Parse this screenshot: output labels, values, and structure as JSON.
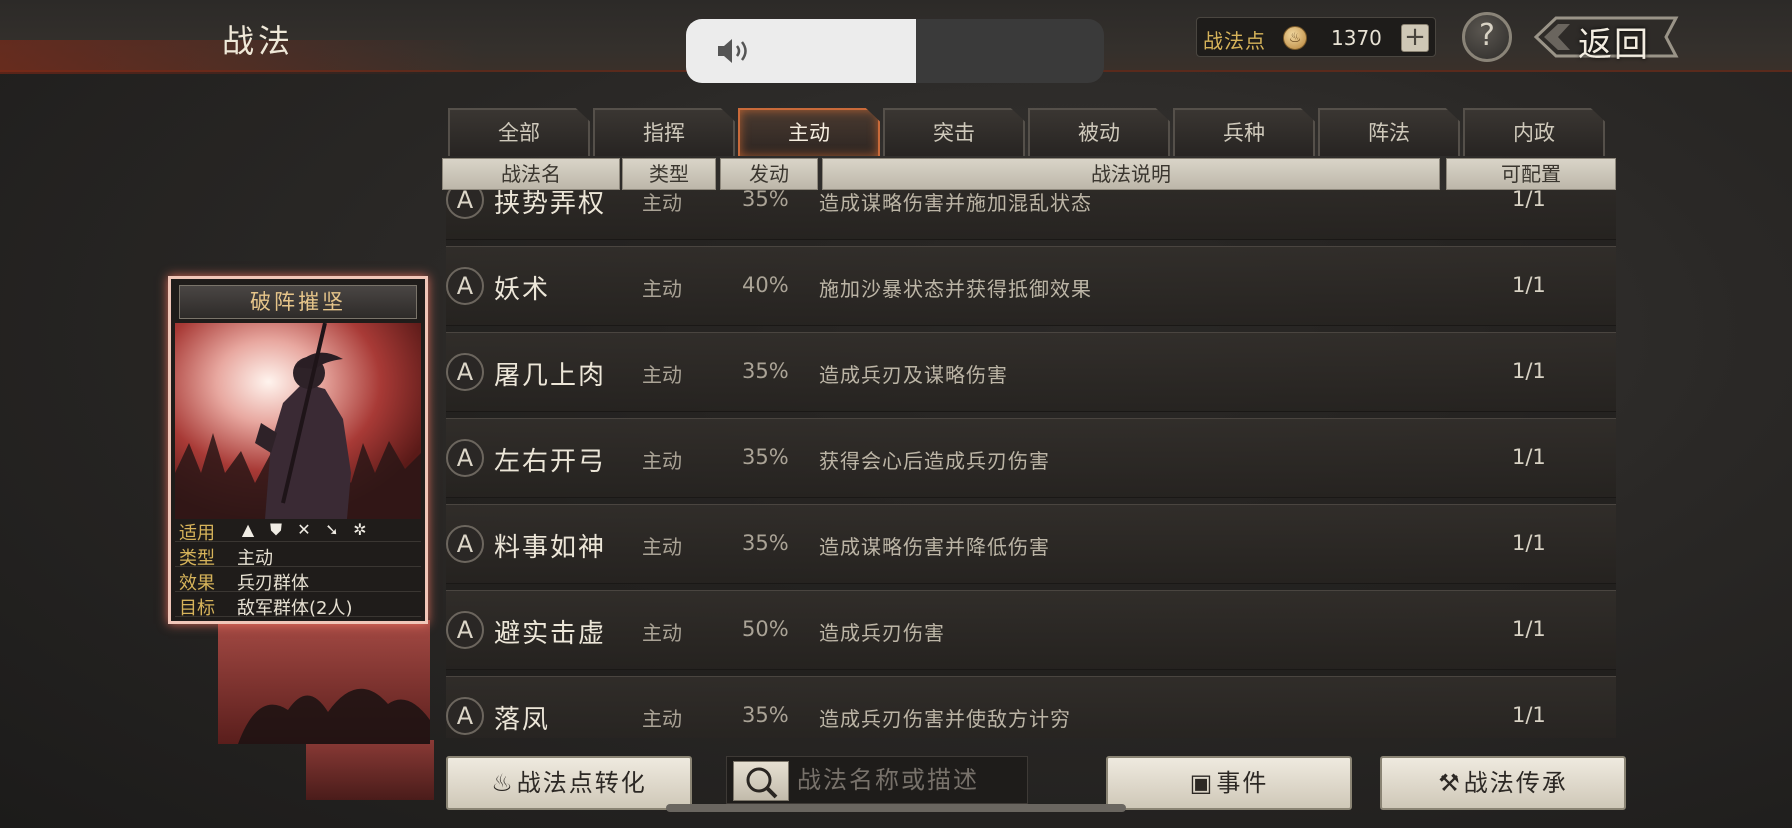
{
  "header": {
    "title": "战法",
    "points_label": "战法点",
    "points_value": "1370",
    "plus_label": "+",
    "help_label": "?",
    "back_label": "返回"
  },
  "volume": {
    "level": 0.55
  },
  "tabs": [
    {
      "label": "全部",
      "active": false
    },
    {
      "label": "指挥",
      "active": false
    },
    {
      "label": "主动",
      "active": true
    },
    {
      "label": "突击",
      "active": false
    },
    {
      "label": "被动",
      "active": false
    },
    {
      "label": "兵种",
      "active": false
    },
    {
      "label": "阵法",
      "active": false
    },
    {
      "label": "内政",
      "active": false
    }
  ],
  "columns": [
    "战法名",
    "类型",
    "发动",
    "战法说明",
    "可配置"
  ],
  "rows": [
    {
      "grade": "A",
      "name": "挟势弄权",
      "type": "主动",
      "rate": "35%",
      "desc": "造成谋略伤害并施加混乱状态",
      "slots": "1/1"
    },
    {
      "grade": "A",
      "name": "妖术",
      "type": "主动",
      "rate": "40%",
      "desc": "施加沙暴状态并获得抵御效果",
      "slots": "1/1"
    },
    {
      "grade": "A",
      "name": "屠几上肉",
      "type": "主动",
      "rate": "35%",
      "desc": "造成兵刃及谋略伤害",
      "slots": "1/1"
    },
    {
      "grade": "A",
      "name": "左右开弓",
      "type": "主动",
      "rate": "35%",
      "desc": "获得会心后造成兵刃伤害",
      "slots": "1/1"
    },
    {
      "grade": "A",
      "name": "料事如神",
      "type": "主动",
      "rate": "35%",
      "desc": "造成谋略伤害并降低伤害",
      "slots": "1/1"
    },
    {
      "grade": "A",
      "name": "避实击虚",
      "type": "主动",
      "rate": "50%",
      "desc": "造成兵刃伤害",
      "slots": "1/1"
    },
    {
      "grade": "A",
      "name": "落凤",
      "type": "主动",
      "rate": "35%",
      "desc": "造成兵刃伤害并使敌方计穷",
      "slots": "1/1"
    }
  ],
  "card": {
    "title": "破阵摧坚",
    "applies_label": "适用",
    "unit_icons": [
      "cavalry-icon",
      "shield-icon",
      "bow-icon",
      "spear-icon",
      "wheel-icon"
    ],
    "type_label": "类型",
    "type_value": "主动",
    "effect_label": "效果",
    "effect_value": "兵刃群体",
    "target_label": "目标",
    "target_value": "敌军群体(2人)"
  },
  "bottom": {
    "convert_label": "战法点转化",
    "search_placeholder": "战法名称或描述",
    "events_label": "事件",
    "inherit_label": "战法传承"
  },
  "colors": {
    "accent": "#c96a3a",
    "gold": "#d6b35a",
    "card_glow": "#f1c6b8"
  }
}
